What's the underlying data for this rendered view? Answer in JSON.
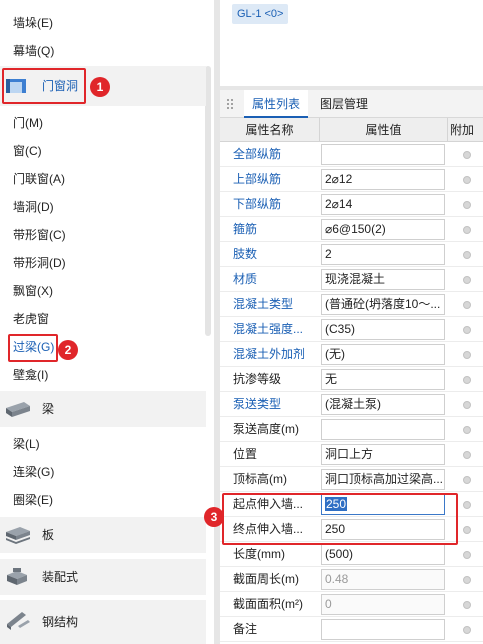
{
  "left_panel": {
    "items_top": [
      "墙垛(E)",
      "幕墙(Q)"
    ],
    "category_door": {
      "label": "门窗洞",
      "badge": "1"
    },
    "door_items": [
      "门(M)",
      "窗(C)",
      "门联窗(A)",
      "墙洞(D)",
      "带形窗(C)",
      "带形洞(D)",
      "飘窗(X)",
      "老虎窗",
      "过梁(G)",
      "壁龛(I)"
    ],
    "lintel_badge": "2",
    "category_beam": {
      "label": "梁"
    },
    "beam_items": [
      "梁(L)",
      "连梁(G)",
      "圈梁(E)"
    ],
    "category_slab": {
      "label": "板"
    },
    "category_prefab": {
      "label": "装配式"
    },
    "category_steel": {
      "label": "钢结构"
    }
  },
  "right_top": {
    "tag": "GL-1 <0>"
  },
  "property_panel": {
    "tabs": [
      "属性列表",
      "图层管理"
    ],
    "headers": {
      "name": "属性名称",
      "value": "属性值",
      "add": "附加"
    },
    "rows": [
      {
        "name": "全部纵筋",
        "value": "",
        "blue": true
      },
      {
        "name": "上部纵筋",
        "value": "2⌀12",
        "blue": true
      },
      {
        "name": "下部纵筋",
        "value": "2⌀14",
        "blue": true
      },
      {
        "name": "箍筋",
        "value": "⌀6@150(2)",
        "blue": true
      },
      {
        "name": "肢数",
        "value": "2",
        "blue": true
      },
      {
        "name": "材质",
        "value": "现浇混凝土",
        "blue": true
      },
      {
        "name": "混凝土类型",
        "value": "(普通砼(坍落度10～...",
        "blue": true
      },
      {
        "name": "混凝土强度...",
        "value": "(C35)",
        "blue": true
      },
      {
        "name": "混凝土外加剂",
        "value": "(无)",
        "blue": true
      },
      {
        "name": "抗渗等级",
        "value": "无",
        "blue": false
      },
      {
        "name": "泵送类型",
        "value": "(混凝土泵)",
        "blue": true
      },
      {
        "name": "泵送高度(m)",
        "value": "",
        "blue": false
      },
      {
        "name": "位置",
        "value": "洞口上方",
        "blue": false
      },
      {
        "name": "顶标高(m)",
        "value": "洞口顶标高加过梁高...",
        "blue": false
      },
      {
        "name": "起点伸入墙...",
        "value": "250",
        "blue": false
      },
      {
        "name": "终点伸入墙...",
        "value": "250",
        "blue": false
      },
      {
        "name": "长度(mm)",
        "value": "(500)",
        "blue": false
      },
      {
        "name": "截面周长(m)",
        "value": "0.48",
        "blue": false
      },
      {
        "name": "截面面积(m²)",
        "value": "0",
        "blue": false
      },
      {
        "name": "备注",
        "value": "",
        "blue": false
      }
    ],
    "badge": "3"
  },
  "colors": {
    "accent": "#1a5fb4",
    "highlight": "#e0262a"
  }
}
